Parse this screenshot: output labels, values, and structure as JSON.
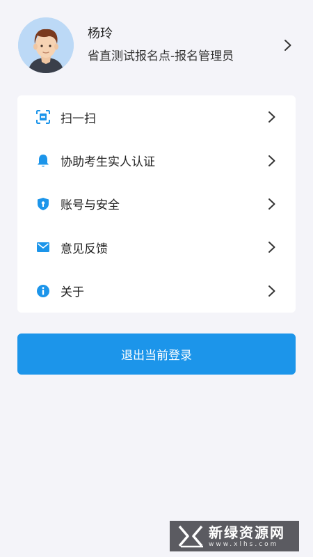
{
  "profile": {
    "name": "杨玲",
    "role": "省直测试报名点-报名管理员"
  },
  "menu": {
    "items": [
      {
        "label": "扫一扫",
        "icon": "scan-icon"
      },
      {
        "label": "协助考生实人认证",
        "icon": "bell-icon"
      },
      {
        "label": "账号与安全",
        "icon": "shield-icon"
      },
      {
        "label": "意见反馈",
        "icon": "mail-icon"
      },
      {
        "label": "关于",
        "icon": "info-icon"
      }
    ]
  },
  "logout": {
    "label": "退出当前登录"
  },
  "watermark": {
    "title": "新绿资源网",
    "subtitle": "www.xlhs.com"
  },
  "colors": {
    "accent": "#1c95ea",
    "background": "#f4f4f9",
    "card": "#ffffff",
    "avatar_bg": "#bcd9f6"
  }
}
